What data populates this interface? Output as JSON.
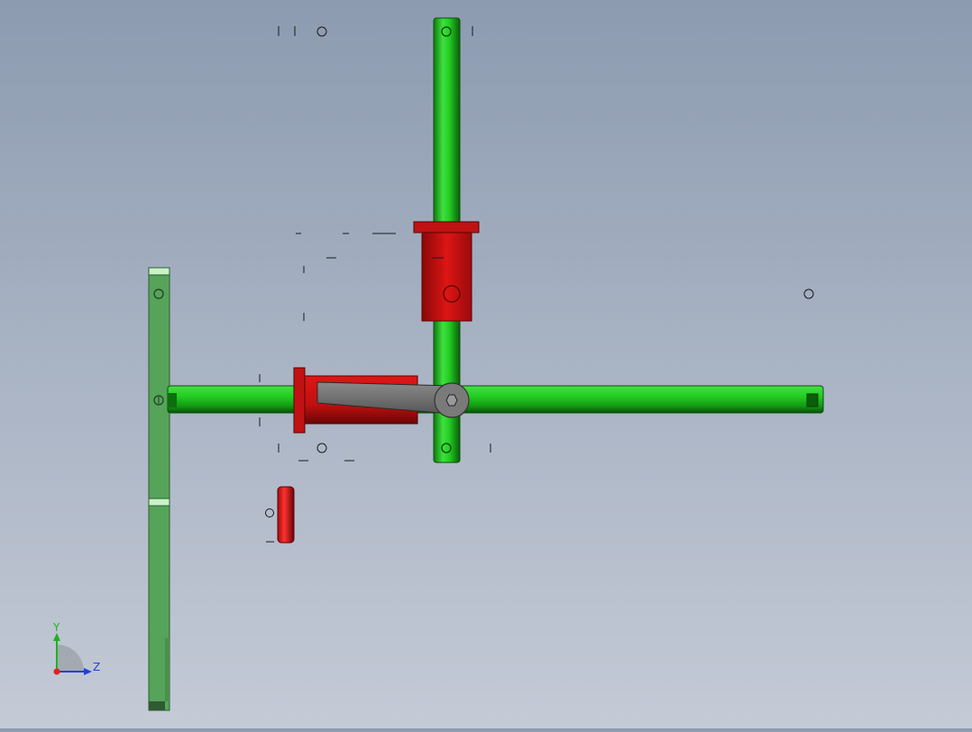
{
  "viewport": {
    "background_top": "#8c9bb0",
    "background_bottom": "#c4cad6"
  },
  "colors": {
    "shaft_green": "#22cc22",
    "shaft_green_dark": "#0b6e0b",
    "plate_green": "#56a35a",
    "block_red": "#d01414",
    "block_red_dark": "#7a0606",
    "arm_gray": "#6e6e6e"
  },
  "triad": {
    "y_label": "Y",
    "z_label": "Z",
    "x_color": "#e02020",
    "y_color": "#20b020",
    "z_color": "#2040e0"
  },
  "parts": {
    "vertical_shaft": "green-shaft",
    "horizontal_shaft": "green-shaft",
    "left_plate": "mounting-plate",
    "upper_block": "red-bearing-block",
    "lower_block": "red-bearing-block",
    "small_disc": "red-disc",
    "arm": "gray-lever-arm",
    "hex_bolt": "hex-socket-bolt"
  }
}
